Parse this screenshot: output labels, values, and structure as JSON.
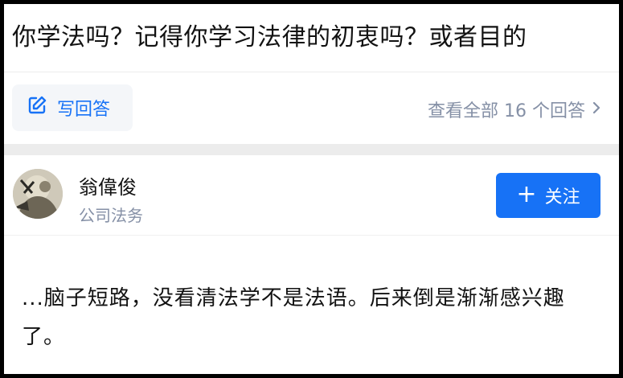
{
  "question": {
    "title": "你学法吗？记得你学习法律的初衷吗？或者目的"
  },
  "actions": {
    "write_answer_label": "写回答",
    "view_all_label": "查看全部 16 个回答"
  },
  "author": {
    "name": "翁偉俊",
    "tag": "公司法务",
    "follow_label": "关注"
  },
  "answer": {
    "excerpt": "...脑子短路，没看清法学不是法语。后来倒是渐渐感兴趣了。"
  },
  "colors": {
    "accent": "#1772f6",
    "muted": "#8590a6",
    "text": "#121212"
  },
  "icons": {
    "write": "edit-icon",
    "more": "chevron-right-icon",
    "follow": "plus-icon"
  }
}
